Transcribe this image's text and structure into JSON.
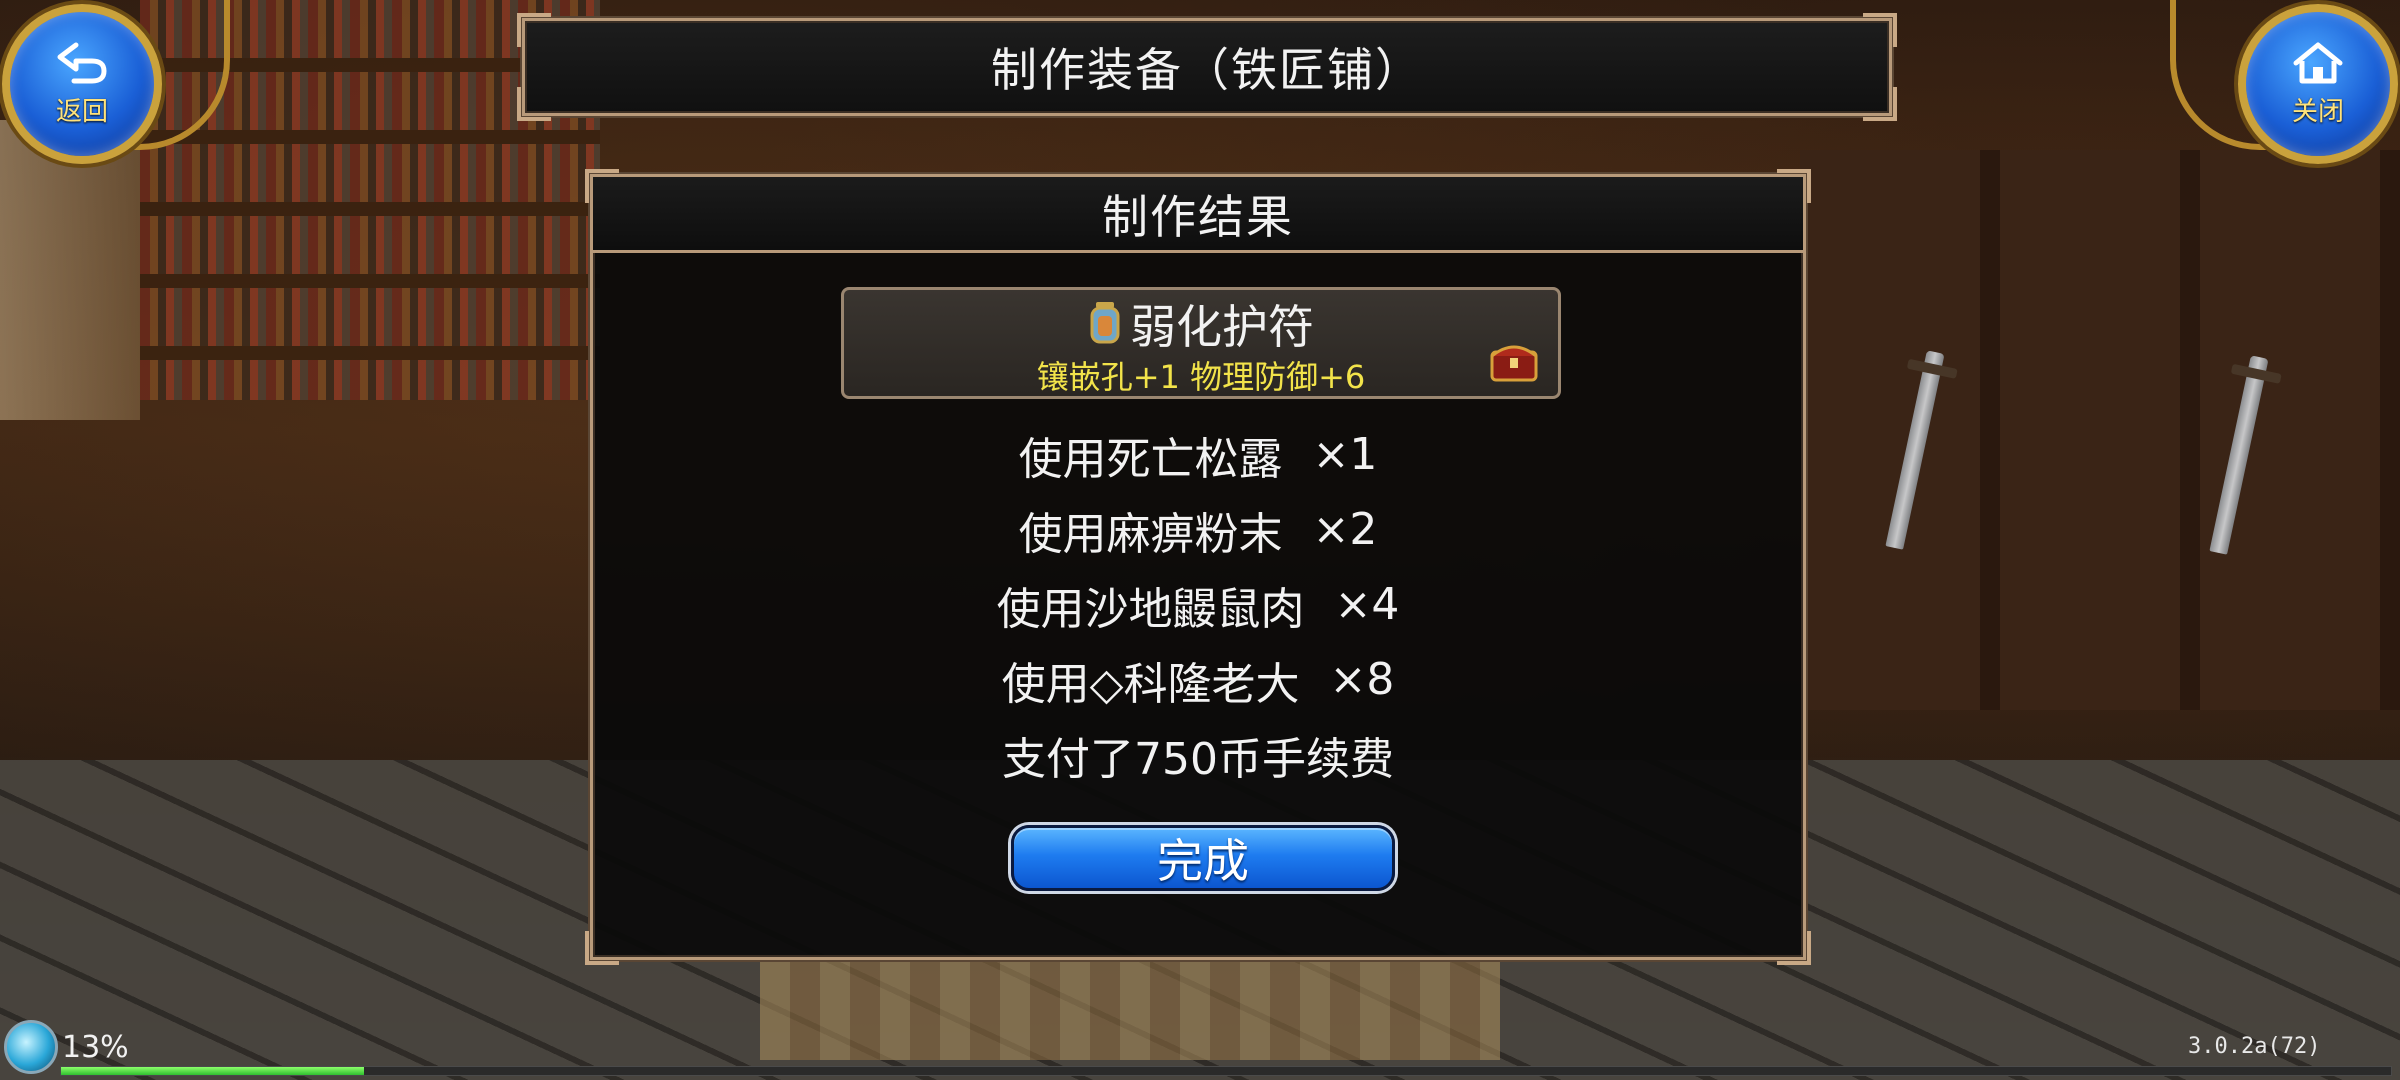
{
  "header": {
    "title": "制作装备（铁匠铺）",
    "back_label": "返回",
    "close_label": "关闭"
  },
  "panel": {
    "title": "制作结果",
    "item": {
      "name": "弱化护符",
      "stats": "镶嵌孔+1  物理防御+6",
      "icon": "amulet-icon",
      "badge_icon": "treasure-chest-icon"
    },
    "lines": [
      {
        "text": "使用死亡松露",
        "qty": "×1"
      },
      {
        "text": "使用麻痹粉末",
        "qty": "×2"
      },
      {
        "text": "使用沙地鼹鼠肉",
        "qty": "×4"
      },
      {
        "text": "使用◇科隆老大",
        "qty": "×8"
      },
      {
        "text": "支付了750币手续费",
        "qty": ""
      }
    ],
    "done_label": "完成"
  },
  "status": {
    "percent": "13%",
    "progress": 0.13,
    "version": "3.0.2a(72)"
  },
  "colors": {
    "accent_blue": "#1e7cf0",
    "stat_yellow": "#f2e34a",
    "frame_gold": "#b89a7a"
  }
}
